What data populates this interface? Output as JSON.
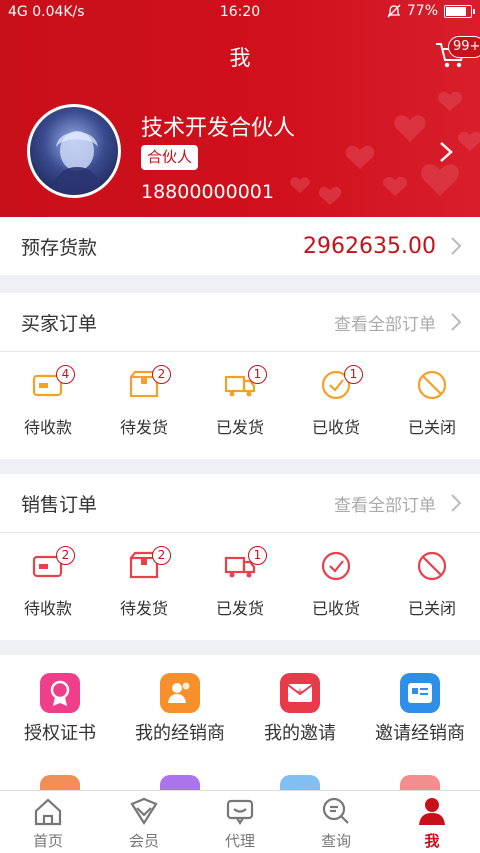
{
  "status_bar": {
    "left": "4G 0.04K/s",
    "time": "16:20",
    "battery": "77%",
    "battery_level": 0.77
  },
  "header": {
    "title": "我",
    "cart_badge": "99+"
  },
  "profile": {
    "name": "技术开发合伙人",
    "tag": "合伙人",
    "phone": "18800000001"
  },
  "deposit": {
    "label": "预存货款",
    "value": "2962635.00"
  },
  "buyer_orders": {
    "title": "买家订单",
    "view_all": "查看全部订单",
    "items": [
      {
        "label": "待收款",
        "badge": "4",
        "icon": "wallet-icon"
      },
      {
        "label": "待发货",
        "badge": "2",
        "icon": "package-icon"
      },
      {
        "label": "已发货",
        "badge": "1",
        "icon": "truck-icon"
      },
      {
        "label": "已收货",
        "badge": "1",
        "icon": "check-circle-icon"
      },
      {
        "label": "已关闭",
        "badge": "",
        "icon": "prohibited-icon"
      }
    ]
  },
  "sales_orders": {
    "title": "销售订单",
    "view_all": "查看全部订单",
    "items": [
      {
        "label": "待收款",
        "badge": "2",
        "icon": "wallet-icon"
      },
      {
        "label": "待发货",
        "badge": "2",
        "icon": "package-icon"
      },
      {
        "label": "已发货",
        "badge": "1",
        "icon": "truck-icon"
      },
      {
        "label": "已收货",
        "badge": "",
        "icon": "check-circle-icon"
      },
      {
        "label": "已关闭",
        "badge": "",
        "icon": "prohibited-icon"
      }
    ]
  },
  "tools": [
    {
      "label": "授权证书",
      "icon": "certificate-icon",
      "color": "#ef3f8a"
    },
    {
      "label": "我的经销商",
      "icon": "dealers-icon",
      "color": "#f7902a"
    },
    {
      "label": "我的邀请",
      "icon": "invitation-icon",
      "color": "#e93a4a"
    },
    {
      "label": "邀请经销商",
      "icon": "invite-dealer-icon",
      "color": "#2f8fe8"
    }
  ],
  "tabbar": [
    {
      "label": "首页",
      "icon": "home-icon",
      "active": false
    },
    {
      "label": "会员",
      "icon": "member-icon",
      "active": false
    },
    {
      "label": "代理",
      "icon": "agent-icon",
      "active": false
    },
    {
      "label": "查询",
      "icon": "query-icon",
      "active": false
    },
    {
      "label": "我",
      "icon": "me-icon",
      "active": true
    }
  ],
  "colors": {
    "brand_red": "#c8101a",
    "buyer_icon": "#f4a12c",
    "sales_icon": "#e8414c"
  }
}
